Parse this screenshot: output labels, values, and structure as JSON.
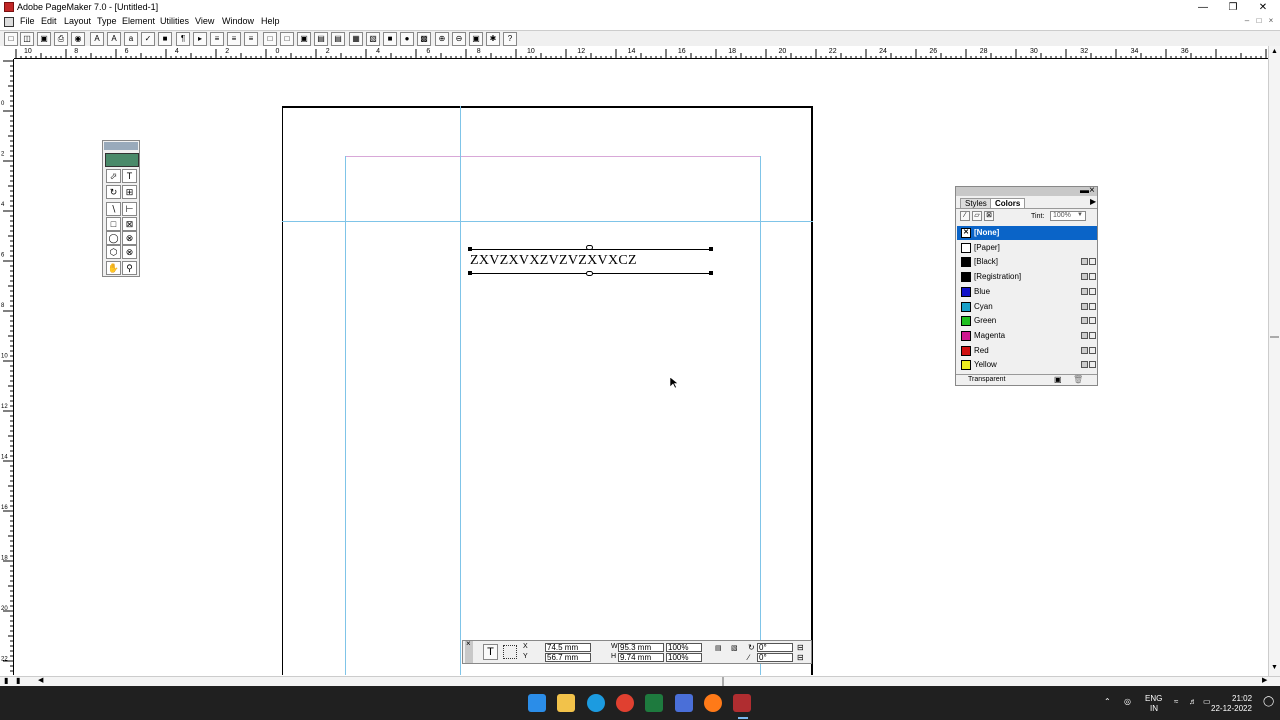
{
  "titlebar": {
    "title": "Adobe PageMaker 7.0 - [Untitled-1]",
    "minimize": "—",
    "maximize": "❐",
    "close": "✕"
  },
  "menubar": {
    "items": [
      "File",
      "Edit",
      "Layout",
      "Type",
      "Element",
      "Utilities",
      "View",
      "Window",
      "Help"
    ]
  },
  "ruler": {
    "h_labels": [
      "10",
      "8",
      "6",
      "4",
      "2",
      "0",
      "2",
      "4",
      "6",
      "8",
      "10",
      "12",
      "14",
      "16",
      "18",
      "20",
      "22",
      "24",
      "26",
      "28",
      "30",
      "32",
      "34",
      "36"
    ],
    "v_labels": [
      "0",
      "2",
      "4",
      "6",
      "8",
      "10",
      "12",
      "14",
      "16",
      "18",
      "20",
      "22"
    ]
  },
  "document": {
    "text": "ZXVZXVXZVZVZXVXCZ"
  },
  "colors_palette": {
    "tabs": [
      "Styles",
      "Colors"
    ],
    "tint_label": "Tint:",
    "tint_value": "100%",
    "footer_label": "Transparent",
    "colors": [
      {
        "name": "[None]",
        "swatch": "#ffffff",
        "selected": true
      },
      {
        "name": "[Paper]",
        "swatch": "#ffffff"
      },
      {
        "name": "[Black]",
        "swatch": "#000000"
      },
      {
        "name": "[Registration]",
        "swatch": "#000000"
      },
      {
        "name": "Blue",
        "swatch": "#1010c8"
      },
      {
        "name": "Cyan",
        "swatch": "#18a0c8"
      },
      {
        "name": "Green",
        "swatch": "#20c020"
      },
      {
        "name": "Magenta",
        "swatch": "#d01890"
      },
      {
        "name": "Red",
        "swatch": "#d01010"
      },
      {
        "name": "Yellow",
        "swatch": "#f0f020"
      }
    ]
  },
  "control_palette": {
    "x_label": "X",
    "x_value": "74.5 mm",
    "y_label": "Y",
    "y_value": "56.7 mm",
    "w_label": "W",
    "w_value": "95.3 mm",
    "h_label": "H",
    "h_value": "9.74 mm",
    "scale_w": "100%",
    "scale_h": "100%",
    "rotate": "0°",
    "skew": "0°"
  },
  "taskbar": {
    "lang_top": "ENG",
    "lang_bottom": "IN",
    "time": "21:02",
    "date": "22-12-2022"
  }
}
